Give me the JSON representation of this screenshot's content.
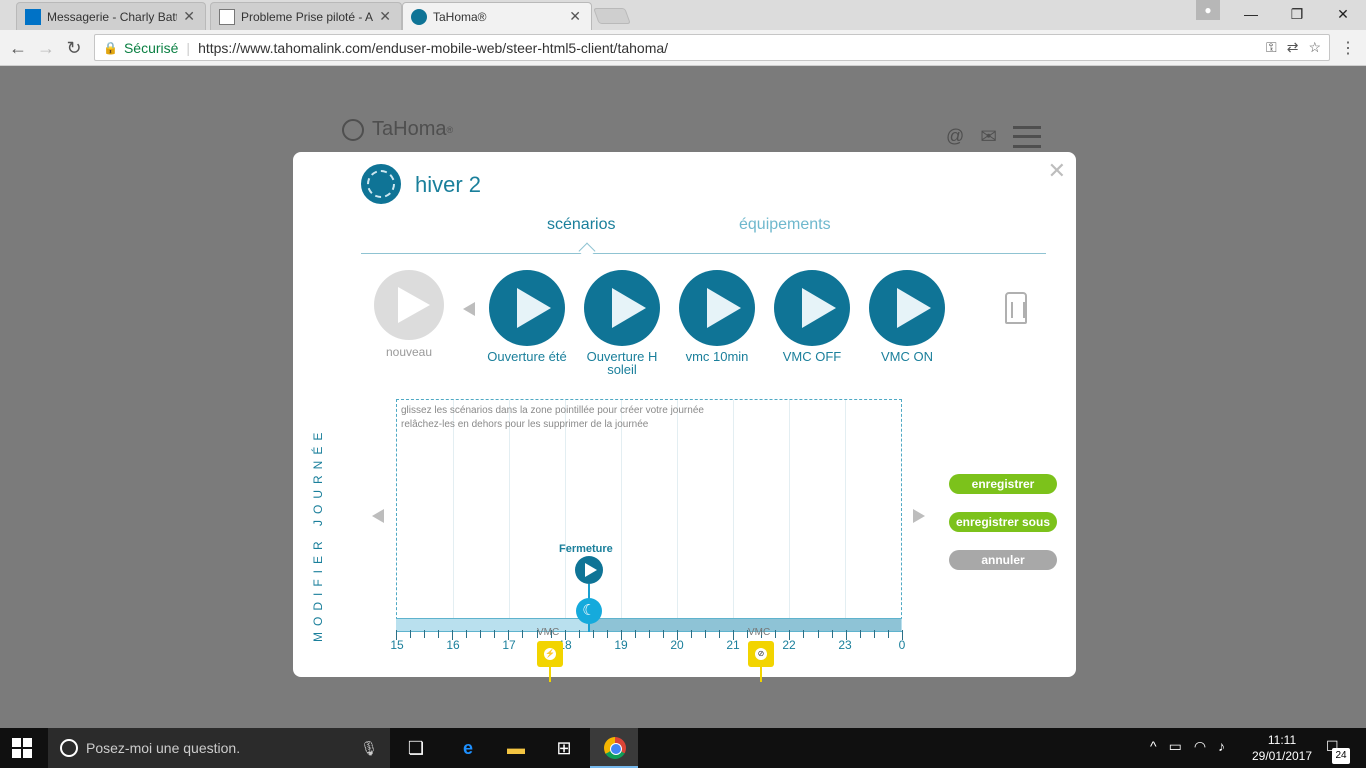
{
  "browser": {
    "tabs": [
      {
        "title": "Messagerie - Charly Batt"
      },
      {
        "title": "Probleme Prise piloté - A"
      },
      {
        "title": "TaHoma®"
      }
    ],
    "secure_label": "Sécurisé",
    "url": "https://www.tahomalink.com/enduser-mobile-web/steer-html5-client/tahoma/"
  },
  "header": {
    "logo": "TaHoma",
    "logo_mark": "®"
  },
  "modal": {
    "title": "hiver 2",
    "tabs": {
      "scenarios": "scénarios",
      "equipements": "équipements"
    },
    "scenarios": [
      {
        "label": "Ouverture été"
      },
      {
        "label": "Ouverture H soleil"
      },
      {
        "label": "vmc 10min"
      },
      {
        "label": "VMC OFF"
      },
      {
        "label": "VMC ON"
      }
    ],
    "new_label": "nouveau",
    "vertical_label": "MODIFIER JOURNÉE",
    "hint_line1": "glissez les scénarios dans la zone pointillée pour créer votre journée",
    "hint_line2": "relâchez-les en dehors pour les supprimer de la journée",
    "timeline_hours": [
      "15",
      "16",
      "17",
      "18",
      "19",
      "20",
      "21",
      "22",
      "23",
      "0"
    ],
    "event_fermeture": "Fermeture",
    "event_vmc_1": "VMC",
    "event_vmc_2": "VMC",
    "buttons": {
      "save": "enregistrer",
      "save_as": "enregistrer sous",
      "cancel": "annuler"
    }
  },
  "taskbar": {
    "search_placeholder": "Posez-moi une question.",
    "time": "11:11",
    "date": "29/01/2017",
    "notifications": "24"
  },
  "colors": {
    "accent": "#0f7496",
    "green": "#7cc21b",
    "vmc_yellow": "#f2d400"
  }
}
